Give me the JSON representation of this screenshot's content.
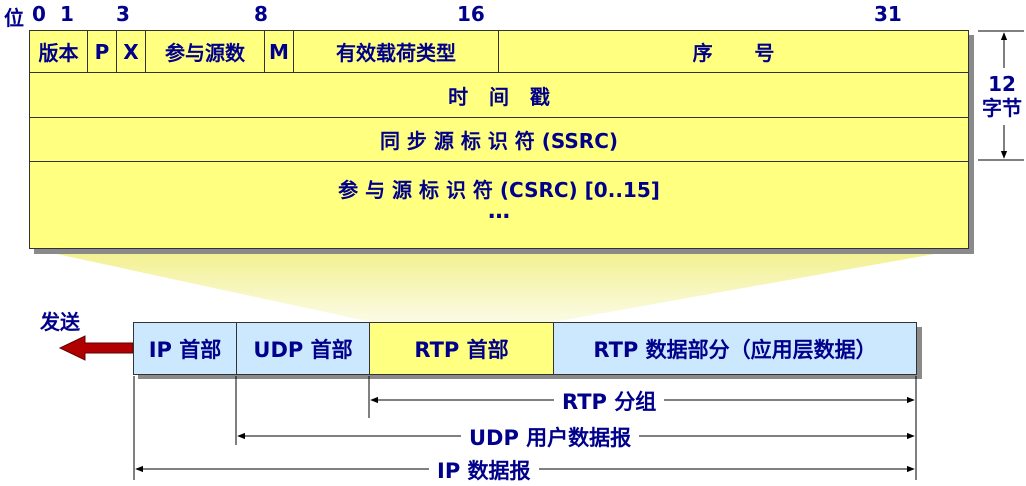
{
  "header": {
    "bit_label": "位",
    "bits": [
      "0",
      "1",
      "3",
      "8",
      "16",
      "31"
    ]
  },
  "rtp_header": {
    "row1": {
      "version": "版本",
      "p": "P",
      "x": "X",
      "cc": "参与源数",
      "m": "M",
      "payload_type": "有效载荷类型",
      "sequence": "序      号"
    },
    "timestamp": "时   间   戳",
    "ssrc": "同 步 源 标 识 符 (SSRC)",
    "csrc": "参 与 源 标 识 符 (CSRC) [0..15]",
    "ellipsis": "…"
  },
  "size_label": {
    "value": "12",
    "unit": "字节"
  },
  "send_label": "发送",
  "packet": {
    "ip_header": "IP 首部",
    "udp_header": "UDP 首部",
    "rtp_header": "RTP 首部",
    "rtp_data": "RTP 数据部分（应用层数据）"
  },
  "spans": {
    "rtp_group": "RTP 分组",
    "udp_datagram": "UDP 用户数据报",
    "ip_datagram": "IP 数据报"
  },
  "colors": {
    "header_fill": "#ffff80",
    "packet_fill": "#cce8ff",
    "rtp_header_fill": "#ffff80",
    "arrow": "#b00000",
    "text": "#00008b"
  }
}
